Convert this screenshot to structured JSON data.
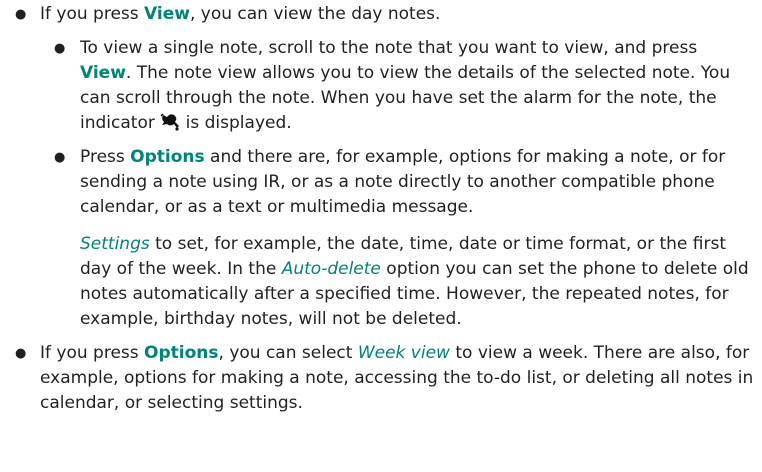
{
  "bullets": {
    "b1": {
      "pre": "If you press ",
      "key": "View",
      "post": ", you can view the day notes."
    },
    "b2": {
      "pre": "To view a single note, scroll to the note that you want to view, and press ",
      "key": "View",
      "post": ". The note view allows you to view the details of the selected note. You can scroll through the note. When you have set the alarm for the note, the indicator ",
      "icon": "alarm-icon",
      "post2": " is displayed."
    },
    "b3": {
      "pre": "Press ",
      "key": "Options",
      "post": " and there are, for example, options for making a note, or for sending a note using IR, or as a note directly to another compatible phone calendar, or as a text or multimedia message."
    },
    "p1": {
      "term1": "Settings",
      "mid1": " to set, for example, the date, time, date or time format, or the first day of the week. In the ",
      "term2": "Auto-delete",
      "mid2": " option you can set the phone to delete old notes automatically after a specified time. However, the repeated notes, for example, birthday notes, will not be deleted."
    },
    "b4": {
      "pre": "If you press ",
      "key": "Options",
      "mid": ", you can select ",
      "term": "Week view",
      "post": " to view a week. There are also, for example, options for making a note, accessing the to-do list, or deleting all notes in calendar, or selecting settings."
    }
  },
  "colors": {
    "keyword": "#00847a",
    "text": "#231f20"
  }
}
